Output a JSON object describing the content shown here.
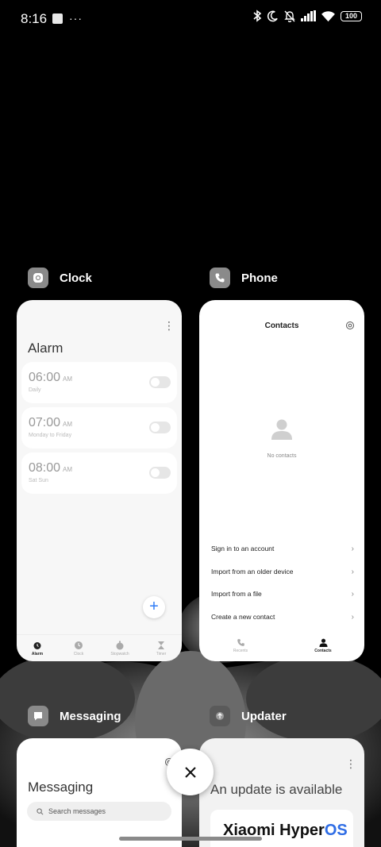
{
  "status_bar": {
    "time": "8:16",
    "overflow": "···",
    "battery": "100",
    "icons": [
      "bluetooth-icon",
      "moon-icon",
      "bell-off-icon",
      "signal-icon",
      "wifi-icon",
      "battery-icon"
    ]
  },
  "apps": [
    {
      "name": "Clock",
      "icon": "clock-app-icon",
      "screen": {
        "title": "Alarm",
        "alarms": [
          {
            "time": "06:00",
            "ampm": "AM",
            "repeat": "Daily"
          },
          {
            "time": "07:00",
            "ampm": "AM",
            "repeat": "Monday to Friday"
          },
          {
            "time": "08:00",
            "ampm": "AM",
            "repeat": "Sat Sun"
          }
        ],
        "fab": "+",
        "tabs": [
          "Alarm",
          "Clock",
          "Stopwatch",
          "Timer"
        ]
      }
    },
    {
      "name": "Phone",
      "icon": "phone-app-icon",
      "screen": {
        "title": "Contacts",
        "empty_text": "No contacts",
        "menu": [
          "Sign in to an account",
          "Import from an older device",
          "Import from a file",
          "Create a new contact"
        ],
        "tabs": [
          "Recents",
          "Contacts"
        ]
      }
    },
    {
      "name": "Messaging",
      "icon": "messaging-app-icon",
      "screen": {
        "title": "Messaging",
        "search_placeholder": "Search messages"
      }
    },
    {
      "name": "Updater",
      "icon": "updater-app-icon",
      "screen": {
        "title": "An update is available",
        "brand_prefix": "Xiaomi Hyper",
        "brand_suffix": "OS"
      }
    }
  ],
  "colors": {
    "accent": "#2f7cf6",
    "brand_os": "#2f6de5"
  }
}
